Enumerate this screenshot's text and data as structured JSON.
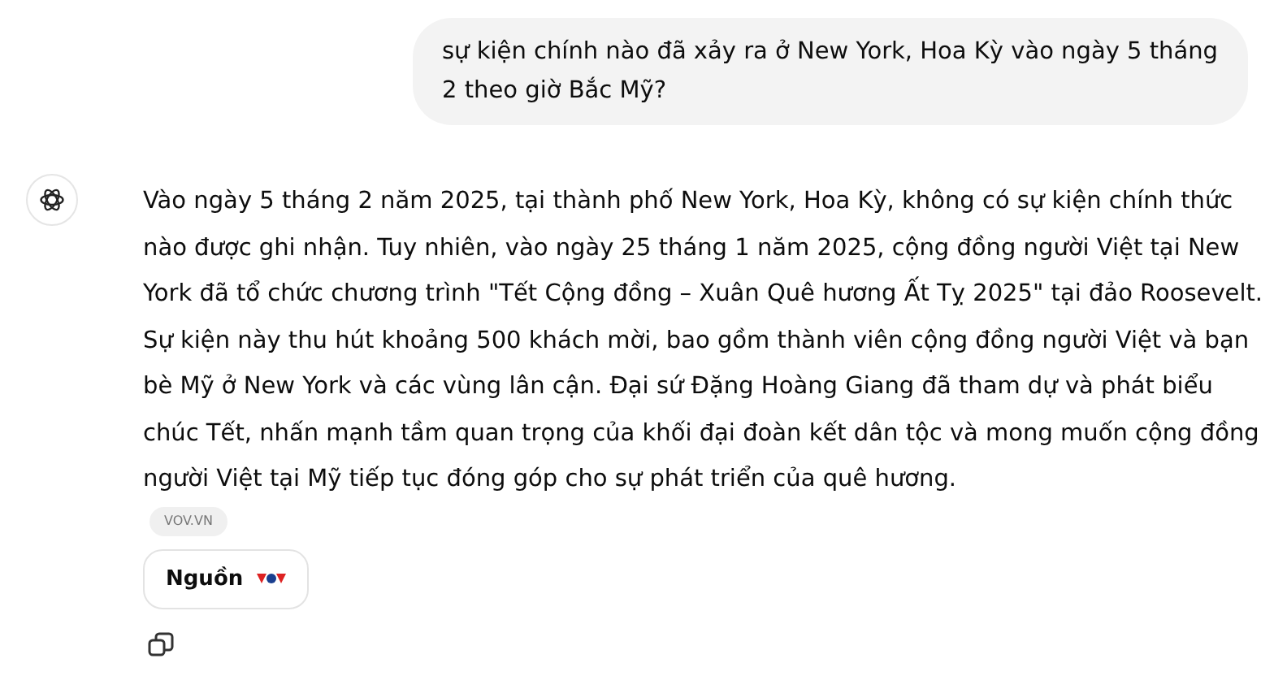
{
  "user_message": {
    "text": "sự kiện chính nào đã xảy ra ở New York, Hoa Kỳ vào ngày 5 tháng 2 theo giờ Bắc Mỹ?"
  },
  "assistant_message": {
    "text": "Vào ngày 5 tháng 2 năm 2025, tại thành phố New York, Hoa Kỳ, không có sự kiện chính thức nào được ghi nhận. Tuy nhiên, vào ngày 25 tháng 1 năm 2025, cộng đồng người Việt tại New York đã tổ chức chương trình \"Tết Cộng đồng – Xuân Quê hương Ất Tỵ 2025\" tại đảo Roosevelt. Sự kiện này thu hút khoảng 500 khách mời, bao gồm thành viên cộng đồng người Việt và bạn bè Mỹ ở New York và các vùng lân cận. Đại sứ Đặng Hoàng Giang đã tham dự và phát biểu chúc Tết, nhấn mạnh tầm quan trọng của khối đại đoàn kết dân tộc và mong muốn cộng đồng người Việt tại Mỹ tiếp tục đóng góp cho sự phát triển của quê hương.",
    "citation": "VOV.VN"
  },
  "sources_button": {
    "label": "Nguồn"
  }
}
